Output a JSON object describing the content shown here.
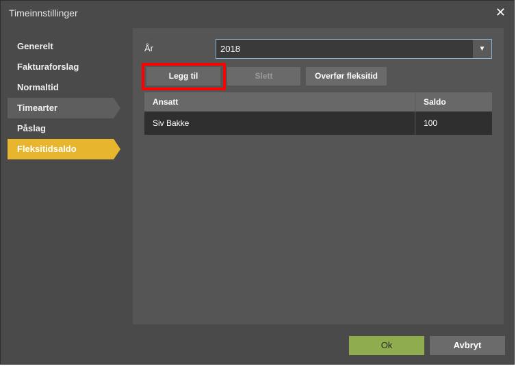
{
  "window": {
    "title": "Timeinnstillinger",
    "close_icon": "close-icon"
  },
  "sidebar": {
    "items": [
      {
        "label": "Generelt",
        "state": "normal"
      },
      {
        "label": "Fakturaforslag",
        "state": "normal"
      },
      {
        "label": "Normaltid",
        "state": "normal"
      },
      {
        "label": "Timearter",
        "state": "hover"
      },
      {
        "label": "Påslag",
        "state": "normal"
      },
      {
        "label": "Fleksitidsaldo",
        "state": "active"
      }
    ],
    "active_color": "#e8b52e"
  },
  "form": {
    "year_label": "År",
    "year_value": "2018"
  },
  "toolbar": {
    "add_label": "Legg til",
    "delete_label": "Slett",
    "transfer_label": "Overfør fleksitid"
  },
  "table": {
    "headers": [
      "Ansatt",
      "Saldo"
    ],
    "rows": [
      {
        "ansatt": "Siv Bakke",
        "saldo": "100"
      }
    ]
  },
  "footer": {
    "ok_label": "Ok",
    "cancel_label": "Avbryt",
    "ok_color": "#8fac4f"
  },
  "annotation": {
    "highlight_color": "#ff0000"
  }
}
